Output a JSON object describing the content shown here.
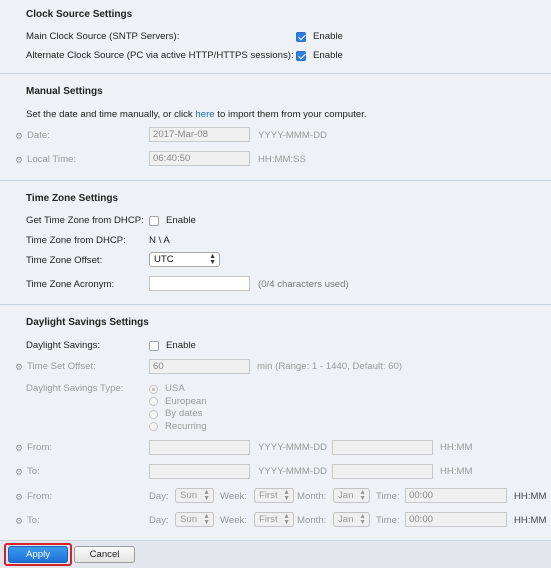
{
  "clock_source": {
    "heading": "Clock Source Settings",
    "main_label": "Main Clock Source (SNTP Servers):",
    "main_enable": "Enable",
    "alt_label": "Alternate Clock Source (PC via active HTTP/HTTPS sessions):",
    "alt_enable": "Enable"
  },
  "manual": {
    "heading": "Manual Settings",
    "desc_before": "Set the date and time manually, or click ",
    "desc_link": "here",
    "desc_after": " to import them from your computer.",
    "date_label": "Date:",
    "date_value": "2017-Mar-08",
    "date_hint": "YYYY-MMM-DD",
    "time_label": "Local Time:",
    "time_value": "06:40:50",
    "time_hint": "HH:MM:SS"
  },
  "timezone": {
    "heading": "Time Zone Settings",
    "dhcp_label": "Get Time Zone from DHCP:",
    "dhcp_enable": "Enable",
    "from_dhcp_label": "Time Zone from DHCP:",
    "from_dhcp_value": "N \\ A",
    "offset_label": "Time Zone Offset:",
    "offset_value": "UTC",
    "acronym_label": "Time Zone Acronym:",
    "acronym_value": "",
    "acronym_hint": "(0/4 characters used)"
  },
  "dst": {
    "heading": "Daylight Savings Settings",
    "enable_label": "Daylight Savings:",
    "enable_text": "Enable",
    "offset_label": "Time Set Offset:",
    "offset_value": "60",
    "offset_hint": "min (Range: 1 - 1440, Default: 60)",
    "type_label": "Daylight Savings Type:",
    "types": [
      "USA",
      "European",
      "By dates",
      "Recurring"
    ],
    "from_label": "From:",
    "to_label": "To:",
    "date_hint": "YYYY-MMM-DD",
    "time_hint": "HH:MM",
    "rec_from_label": "From:",
    "rec_to_label": "To:",
    "day_label": "Day:",
    "week_label": "Week:",
    "month_label": "Month:",
    "time_label": "Time:",
    "day_value": "Sun",
    "week_value": "First",
    "month_value": "Jan",
    "time_value": "00:00",
    "hhmm": "HH:MM"
  },
  "footer": {
    "apply": "Apply",
    "cancel": "Cancel"
  },
  "colors": {
    "accent": "#2f7fe3",
    "link": "#1f6fc5",
    "highlight": "#d6202c"
  }
}
